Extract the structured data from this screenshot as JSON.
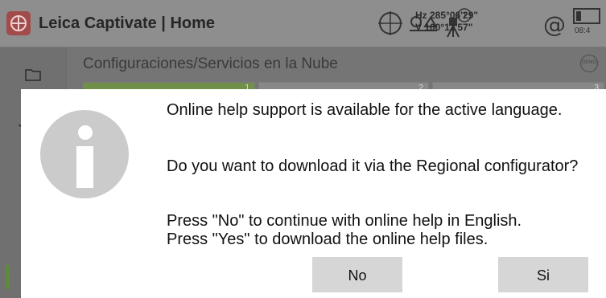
{
  "app": {
    "title": "Leica Captivate | Home",
    "time": "08:4",
    "hz_angle": "Hz 285°06'29\"",
    "v_angle": "V  100°12'57\"",
    "at_symbol": "@"
  },
  "sidebar": {
    "jobs_label": "Jobs"
  },
  "main": {
    "breadcrumb": "Configuraciones/Servicios en la Nube",
    "demo_badge": "DEMO",
    "tiles": [
      {
        "number": "1"
      },
      {
        "number": "2"
      },
      {
        "number": "3"
      }
    ]
  },
  "dialog": {
    "line1": "Online help support is available for the active language.",
    "line2": "Do you want to download it via the Regional configurator?",
    "line3": "Press \"No\" to continue with online help in English.",
    "line4": "Press \"Yes\" to download the online help files.",
    "no_label": "No",
    "yes_label": "Si"
  },
  "colors": {
    "brand_red": "#a24b4b",
    "active_tile_green": "#70904a",
    "button_grey": "#d6d6d6"
  },
  "icons": [
    "leica-logo-icon",
    "target-icon",
    "prism-icon",
    "instrument-icon",
    "at-icon",
    "battery-icon",
    "folder-icon",
    "demo-icon",
    "info-icon"
  ]
}
